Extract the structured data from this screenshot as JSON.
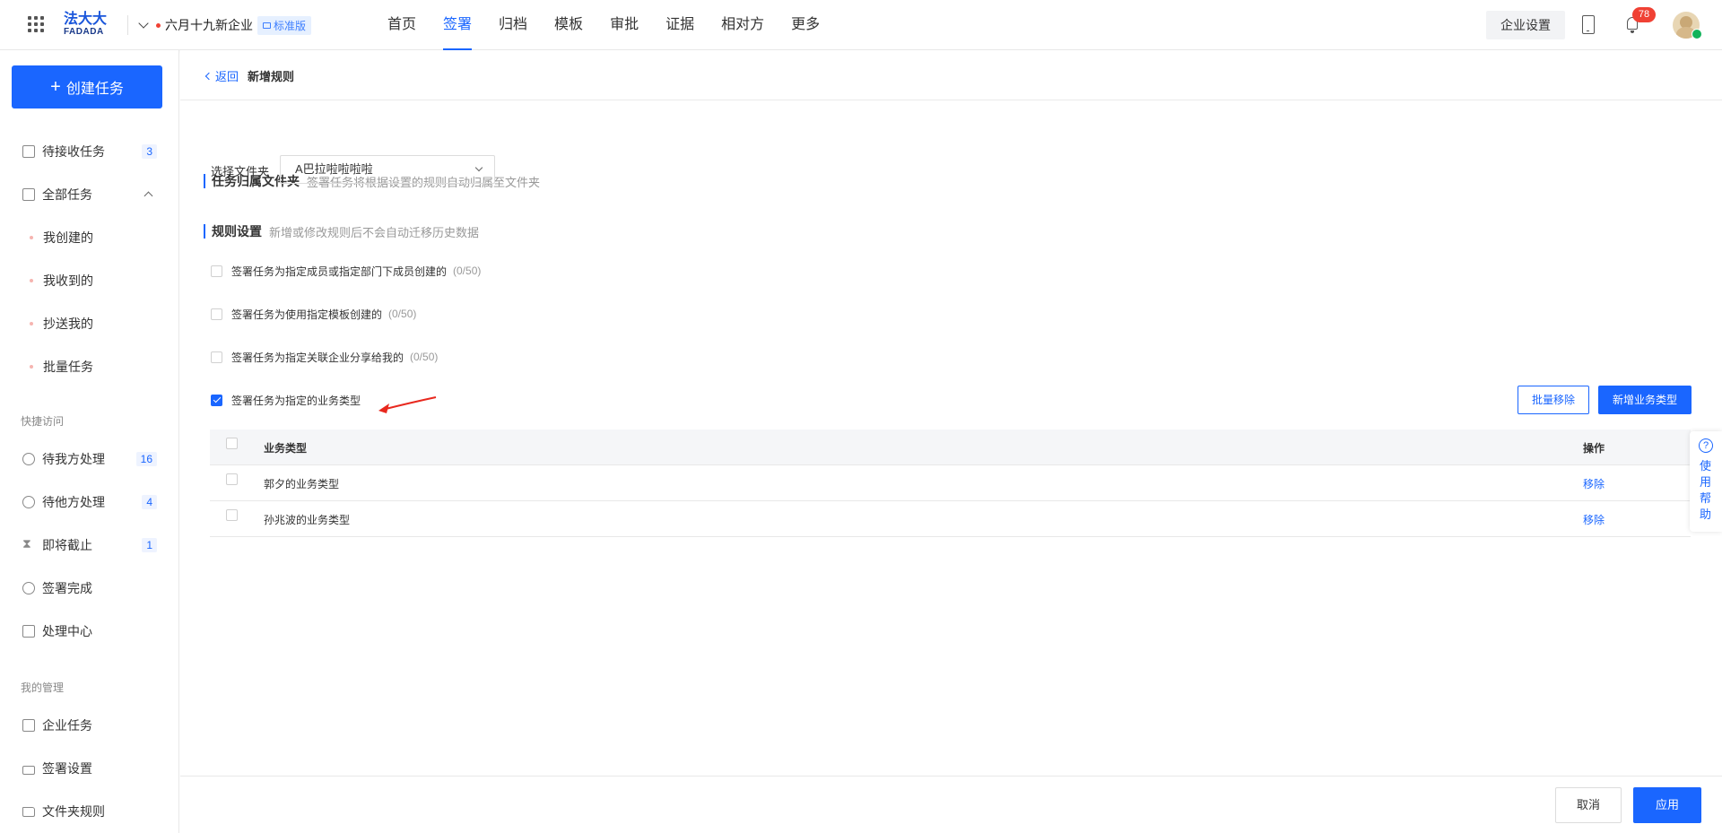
{
  "header": {
    "logo_cn": "法大大",
    "logo_en": "FADADA",
    "company": "六月十九新企业",
    "edition": "标准版",
    "nav": [
      "首页",
      "签署",
      "归档",
      "模板",
      "审批",
      "证据",
      "相对方",
      "更多"
    ],
    "active_nav": "签署",
    "ent_setting": "企业设置",
    "notification_count": "78"
  },
  "sidebar": {
    "create_btn": "创建任务",
    "items": [
      {
        "label": "待接收任务",
        "count": "3"
      },
      {
        "label": "全部任务"
      }
    ],
    "sub_items": [
      "我创建的",
      "我收到的",
      "抄送我的",
      "批量任务"
    ],
    "quick_group": "快捷访问",
    "quick_items": [
      {
        "label": "待我方处理",
        "count": "16"
      },
      {
        "label": "待他方处理",
        "count": "4"
      },
      {
        "label": "即将截止",
        "count": "1"
      },
      {
        "label": "签署完成"
      },
      {
        "label": "处理中心"
      }
    ],
    "manage_group": "我的管理",
    "manage_items": [
      "企业任务",
      "签署设置",
      "文件夹规则"
    ]
  },
  "breadcrumb": {
    "back": "返回",
    "title": "新增规则"
  },
  "folder_section": {
    "title": "任务归属文件夹",
    "desc": "签署任务将根据设置的规则自动归属至文件夹",
    "label": "选择文件夹",
    "value": "A巴拉啦啦啦啦"
  },
  "rule_section": {
    "title": "规则设置",
    "desc": "新增或修改规则后不会自动迁移历史数据",
    "rules": [
      {
        "label": "签署任务为指定成员或指定部门下成员创建的",
        "count": "(0/50)",
        "checked": false
      },
      {
        "label": "签署任务为使用指定模板创建的",
        "count": "(0/50)",
        "checked": false
      },
      {
        "label": "签署任务为指定关联企业分享给我的",
        "count": "(0/50)",
        "checked": false
      },
      {
        "label": "签署任务为指定的业务类型",
        "checked": true
      }
    ],
    "batch_remove": "批量移除",
    "add_type": "新增业务类型"
  },
  "table": {
    "col_type": "业务类型",
    "col_action": "操作",
    "rows": [
      {
        "type": "郭夕的业务类型",
        "action": "移除"
      },
      {
        "type": "孙兆波的业务类型",
        "action": "移除"
      }
    ]
  },
  "help": {
    "q": "?",
    "text": "使用帮助"
  },
  "footer": {
    "cancel": "取消",
    "apply": "应用"
  },
  "colors": {
    "primary": "#1a66ff",
    "badge": "#f04134",
    "annotation_arrow": "#e8281e"
  }
}
